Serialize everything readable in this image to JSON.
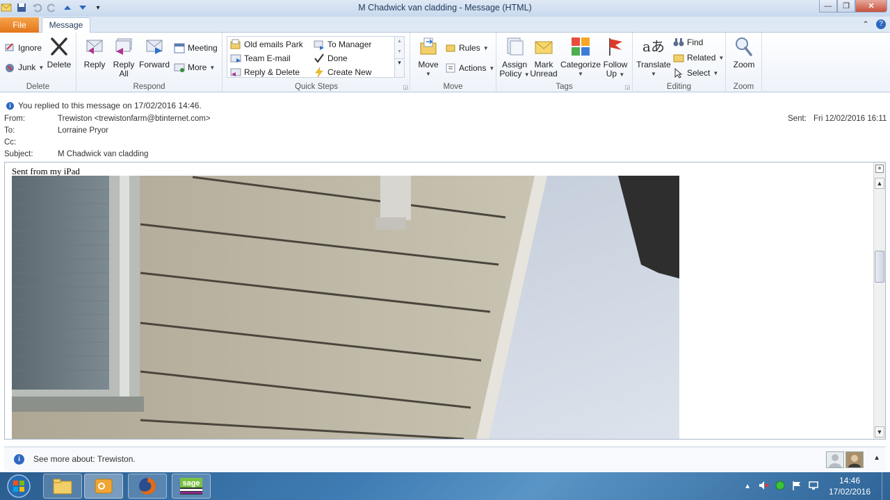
{
  "window": {
    "title": "M Chadwick van cladding  -  Message (HTML)"
  },
  "tabs": {
    "file": "File",
    "message": "Message"
  },
  "ribbon": {
    "delete": {
      "label": "Delete",
      "ignore": "Ignore",
      "junk": "Junk",
      "delete": "Delete"
    },
    "respond": {
      "label": "Respond",
      "reply": "Reply",
      "reply_all_line1": "Reply",
      "reply_all_line2": "All",
      "forward": "Forward",
      "meeting": "Meeting",
      "more": "More"
    },
    "quick_steps": {
      "label": "Quick Steps",
      "items": [
        "Old emails Park",
        "To Manager",
        "Team E-mail",
        "Done",
        "Reply & Delete",
        "Create New"
      ]
    },
    "move": {
      "label": "Move",
      "move": "Move",
      "rules": "Rules",
      "actions": "Actions"
    },
    "tags": {
      "label": "Tags",
      "assign_line1": "Assign",
      "assign_line2": "Policy",
      "mark_line1": "Mark",
      "mark_line2": "Unread",
      "categorize": "Categorize",
      "follow_line1": "Follow",
      "follow_line2": "Up"
    },
    "editing": {
      "label": "Editing",
      "translate": "Translate",
      "find": "Find",
      "related": "Related",
      "select": "Select"
    },
    "zoom": {
      "label": "Zoom",
      "zoom": "Zoom"
    }
  },
  "message": {
    "info": "You replied to this message on 17/02/2016 14:46.",
    "from_label": "From:",
    "from": "Trewiston <trewistonfarm@btinternet.com>",
    "to_label": "To:",
    "to": "Lorraine Pryor",
    "cc_label": "Cc:",
    "cc": "",
    "subject_label": "Subject:",
    "subject": "M Chadwick van cladding",
    "sent_label": "Sent:",
    "sent": "Fri 12/02/2016 16:11",
    "body": "Sent from my iPad"
  },
  "people_pane": {
    "text": "See more about: Trewiston."
  },
  "taskbar": {
    "time": "14:46",
    "date": "17/02/2016"
  },
  "colors": {
    "file_tab": "#e2761c",
    "ribbon_bg": "#eef3fa",
    "taskbar": "#3f7cb3"
  }
}
